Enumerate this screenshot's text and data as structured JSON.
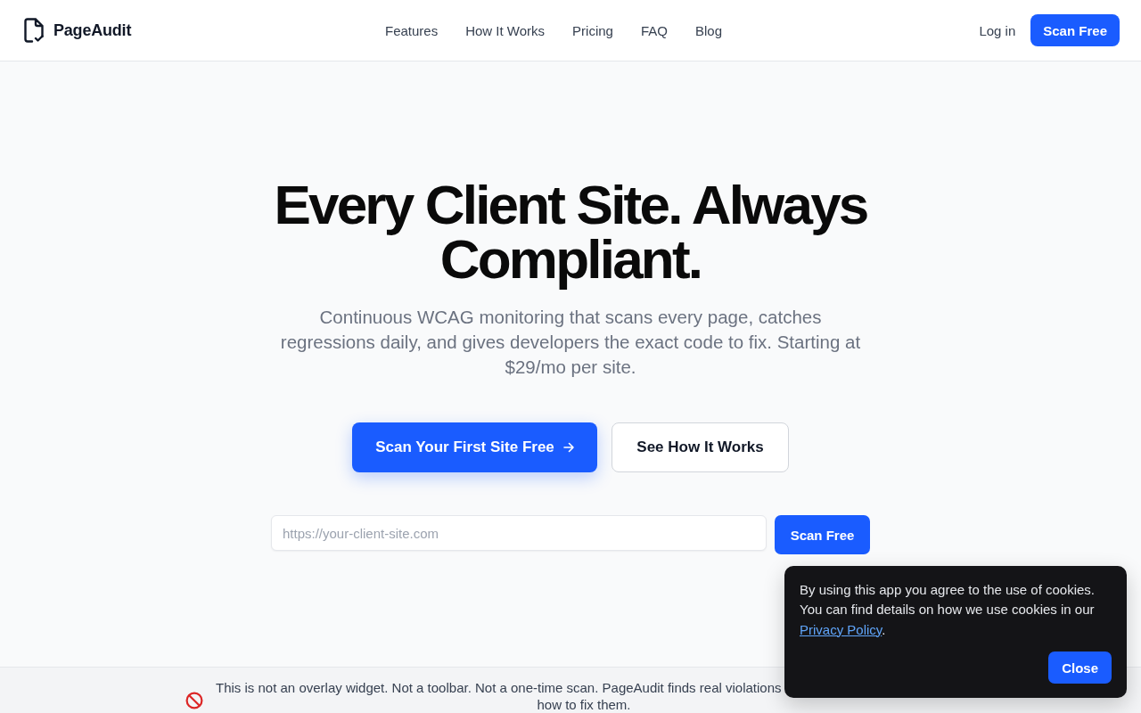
{
  "header": {
    "logo": {
      "name": "PageAudit"
    },
    "nav": [
      "Features",
      "How It Works",
      "Pricing",
      "FAQ",
      "Blog"
    ],
    "login": "Log in",
    "cta": "Scan Free"
  },
  "hero": {
    "title": "Every Client Site. Always Compliant.",
    "subtitle": "Continuous WCAG monitoring that scans every page, catches regressions daily, and gives developers the exact code to fix. Starting at $29/mo per site.",
    "primary_button": "Scan Your First Site Free",
    "secondary_button": "See How It Works",
    "url_field": {
      "placeholder": "https://your-client-site.com"
    },
    "scan_button": "Scan Free"
  },
  "banner": {
    "lines": [
      "This is not an overlay widget. Not a toolbar. Not a one-time scan. PageAudit finds real violations",
      "how to fix them."
    ]
  },
  "cookie_notice": {
    "text": "By using this app you agree to the use of cookies. You can find details on how we use cookies in our",
    "link": "Privacy Policy",
    "after_link": ".",
    "button": "Close"
  }
}
